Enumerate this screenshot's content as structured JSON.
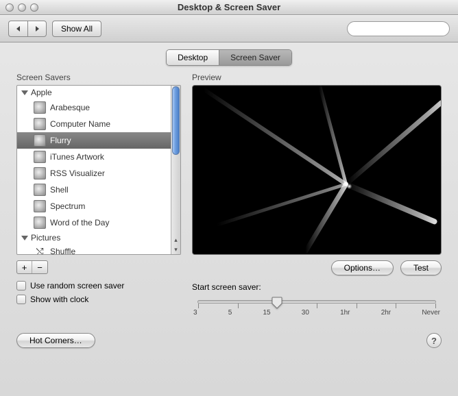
{
  "window": {
    "title": "Desktop & Screen Saver"
  },
  "toolbar": {
    "show_all": "Show All",
    "search_placeholder": ""
  },
  "tabs": {
    "desktop": "Desktop",
    "screensaver": "Screen Saver",
    "active": "screensaver"
  },
  "labels": {
    "screensavers": "Screen Savers",
    "preview": "Preview"
  },
  "list": {
    "groups": [
      {
        "name": "Apple",
        "expanded": true,
        "items": [
          {
            "label": "Arabesque",
            "selected": false
          },
          {
            "label": "Computer Name",
            "selected": false
          },
          {
            "label": "Flurry",
            "selected": true
          },
          {
            "label": "iTunes Artwork",
            "selected": false
          },
          {
            "label": "RSS Visualizer",
            "selected": false
          },
          {
            "label": "Shell",
            "selected": false
          },
          {
            "label": "Spectrum",
            "selected": false
          },
          {
            "label": "Word of the Day",
            "selected": false
          }
        ]
      },
      {
        "name": "Pictures",
        "expanded": true,
        "items": [
          {
            "label": "Shuffle",
            "selected": false,
            "icon": "shuffle"
          }
        ]
      }
    ]
  },
  "buttons": {
    "add": "+",
    "remove": "−",
    "options": "Options…",
    "test": "Test",
    "hot_corners": "Hot Corners…",
    "help": "?"
  },
  "checks": {
    "random": "Use random screen saver",
    "clock": "Show with clock"
  },
  "slider": {
    "label": "Start screen saver:",
    "ticks": [
      "3",
      "5",
      "15",
      "30",
      "1hr",
      "2hr",
      "Never"
    ],
    "value_index": 2
  }
}
